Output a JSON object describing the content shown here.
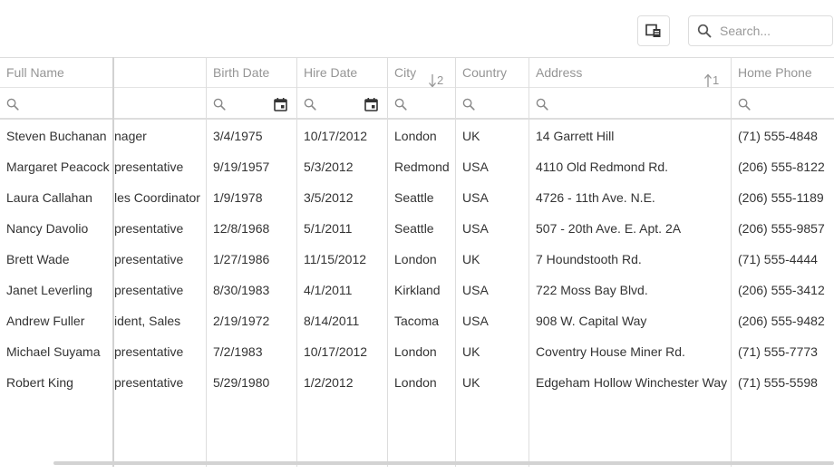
{
  "toolbar": {
    "column_chooser_icon": "column-chooser-icon",
    "search_placeholder": "Search...",
    "search_icon": "search-icon"
  },
  "columns": [
    {
      "key": "full_name",
      "label": "Full Name"
    },
    {
      "key": "position",
      "label": ""
    },
    {
      "key": "birth_date",
      "label": "Birth Date"
    },
    {
      "key": "hire_date",
      "label": "Hire Date"
    },
    {
      "key": "city",
      "label": "City",
      "sort": {
        "direction": "desc",
        "index": "2"
      }
    },
    {
      "key": "country",
      "label": "Country"
    },
    {
      "key": "address",
      "label": "Address",
      "sort": {
        "direction": "asc",
        "index": "1"
      }
    },
    {
      "key": "home_phone",
      "label": "Home Phone"
    }
  ],
  "rows": [
    {
      "full_name": "Steven Buchanan",
      "position": "nager",
      "birth_date": "3/4/1975",
      "hire_date": "10/17/2012",
      "city": "London",
      "country": "UK",
      "address": "14 Garrett Hill",
      "home_phone": "(71) 555-4848"
    },
    {
      "full_name": "Margaret Peacock",
      "position": "presentative",
      "birth_date": "9/19/1957",
      "hire_date": "5/3/2012",
      "city": "Redmond",
      "country": "USA",
      "address": "4110 Old Redmond Rd.",
      "home_phone": "(206) 555-8122"
    },
    {
      "full_name": "Laura Callahan",
      "position": "les Coordinator",
      "birth_date": "1/9/1978",
      "hire_date": "3/5/2012",
      "city": "Seattle",
      "country": "USA",
      "address": "4726 - 11th Ave. N.E.",
      "home_phone": "(206) 555-1189"
    },
    {
      "full_name": "Nancy Davolio",
      "position": "presentative",
      "birth_date": "12/8/1968",
      "hire_date": "5/1/2011",
      "city": "Seattle",
      "country": "USA",
      "address": "507 - 20th Ave. E. Apt. 2A",
      "home_phone": "(206) 555-9857"
    },
    {
      "full_name": "Brett Wade",
      "position": "presentative",
      "birth_date": "1/27/1986",
      "hire_date": "11/15/2012",
      "city": "London",
      "country": "UK",
      "address": "7 Houndstooth Rd.",
      "home_phone": "(71) 555-4444"
    },
    {
      "full_name": "Janet Leverling",
      "position": "presentative",
      "birth_date": "8/30/1983",
      "hire_date": "4/1/2011",
      "city": "Kirkland",
      "country": "USA",
      "address": "722 Moss Bay Blvd.",
      "home_phone": "(206) 555-3412"
    },
    {
      "full_name": "Andrew Fuller",
      "position": "ident, Sales",
      "birth_date": "2/19/1972",
      "hire_date": "8/14/2011",
      "city": "Tacoma",
      "country": "USA",
      "address": "908 W. Capital Way",
      "home_phone": "(206) 555-9482"
    },
    {
      "full_name": "Michael Suyama",
      "position": "presentative",
      "birth_date": "7/2/1983",
      "hire_date": "10/17/2012",
      "city": "London",
      "country": "UK",
      "address": "Coventry House Miner Rd.",
      "home_phone": "(71) 555-7773"
    },
    {
      "full_name": "Robert King",
      "position": "presentative",
      "birth_date": "5/29/1980",
      "hire_date": "1/2/2012",
      "city": "London",
      "country": "UK",
      "address": "Edgeham Hollow Winchester Way",
      "home_phone": "(71) 555-5598"
    }
  ]
}
